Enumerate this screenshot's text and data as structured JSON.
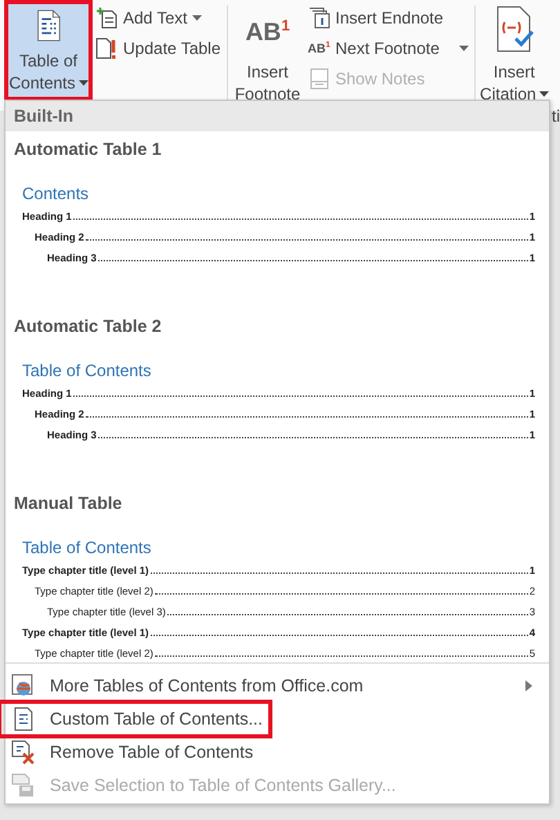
{
  "ribbon": {
    "toc_button": {
      "label_lines": [
        "Table of",
        "Contents"
      ],
      "highlighted": true,
      "selected": true
    },
    "column_1": [
      {
        "label": "Add Text",
        "kind": "add-text",
        "dropdown": true,
        "disabled": false
      },
      {
        "label": "Update Table",
        "kind": "update",
        "dropdown": false,
        "disabled": false
      }
    ],
    "footnote_button": {
      "glyph": "AB",
      "glyph_sup": "1",
      "label_lines": [
        "Insert",
        "Footnote"
      ]
    },
    "column_2": [
      {
        "label": "Insert Endnote",
        "kind": "endnote",
        "dropdown": false,
        "disabled": false
      },
      {
        "label": "Next Footnote",
        "kind": "next",
        "glyph": "AB",
        "glyph_sup": "1",
        "dropdown": true,
        "disabled": false
      },
      {
        "label": "Show Notes",
        "kind": "notes",
        "dropdown": false,
        "disabled": true
      }
    ],
    "citation_button": {
      "label_lines": [
        "Insert",
        "Citation"
      ]
    },
    "group_label_fragment": "ti"
  },
  "menu": {
    "section": "Built-In",
    "galleries": [
      {
        "title": "Automatic Table 1",
        "kind": "automatic",
        "heading": "Contents",
        "entries": [
          {
            "text": "Heading 1",
            "page": "1",
            "children": [
              {
                "text": "Heading 2",
                "page": "1",
                "children": [
                  {
                    "text": "Heading 3",
                    "page": "1"
                  }
                ]
              }
            ]
          }
        ]
      },
      {
        "title": "Automatic Table 2",
        "kind": "automatic",
        "heading": "Table of Contents",
        "entries": [
          {
            "text": "Heading 1",
            "page": "1",
            "children": [
              {
                "text": "Heading 2",
                "page": "1",
                "children": [
                  {
                    "text": "Heading 3",
                    "page": "1"
                  }
                ]
              }
            ]
          }
        ]
      },
      {
        "title": "Manual Table",
        "kind": "manual",
        "heading": "Table of Contents",
        "entries": [
          {
            "text": "Type chapter title (level 1)",
            "page": "1",
            "children": [
              {
                "text": "Type chapter title (level 2)",
                "page": "2",
                "children": [
                  {
                    "text": "Type chapter title (level 3)",
                    "page": "3"
                  }
                ]
              }
            ]
          },
          {
            "text": "Type chapter title (level 1)",
            "page": "4",
            "children": [
              {
                "text": "Type chapter title (level 2)",
                "page": "5"
              }
            ]
          }
        ]
      }
    ],
    "items": [
      {
        "label": "More Tables of Contents from Office.com",
        "kind": "globe",
        "submenu": true,
        "disabled": false,
        "highlighted": false
      },
      {
        "label": "Custom Table of Contents...",
        "kind": "doc",
        "submenu": false,
        "disabled": false,
        "highlighted": true
      },
      {
        "label": "Remove Table of Contents",
        "kind": "remove",
        "submenu": false,
        "disabled": false,
        "highlighted": false
      },
      {
        "label": "Save Selection to Table of Contents Gallery...",
        "kind": "save",
        "submenu": false,
        "disabled": true,
        "highlighted": false
      }
    ]
  }
}
